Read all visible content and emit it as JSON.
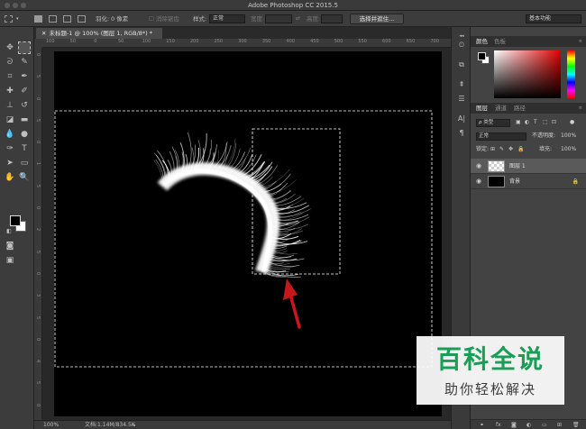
{
  "app": {
    "title": "Adobe Photoshop CC 2015.5"
  },
  "options_bar": {
    "feather_label": "羽化:",
    "feather_value": "0 像素",
    "antialias_label": "消除锯齿",
    "style_label": "样式:",
    "style_value": "正常",
    "width_label": "宽度:",
    "height_label": "高度:",
    "select_mask_button": "选择并遮住...",
    "workspace_value": "基本功能"
  },
  "document": {
    "tab_label": "未标题-1 @ 100% (图层 1, RGB/8*) *",
    "zoom": "100%",
    "doc_info": "文档:1.14M/834.5K"
  },
  "rulers": {
    "h_ticks": [
      "100",
      "50",
      "0",
      "50",
      "100",
      "150",
      "200",
      "250",
      "300",
      "350",
      "400",
      "450",
      "500",
      "550",
      "600",
      "650",
      "700"
    ],
    "v_ticks": [
      "0",
      "5",
      "0",
      "5",
      "0",
      "1",
      "5",
      "0",
      "2",
      "5",
      "0",
      "3",
      "5",
      "0",
      "4",
      "5",
      "0"
    ]
  },
  "panels": {
    "color_tabs": [
      "颜色",
      "色板"
    ],
    "layers_tabs": [
      "图层",
      "通道",
      "路径"
    ],
    "filter_label": "ρ 类型",
    "blend_mode": "正常",
    "opacity_label": "不透明度:",
    "opacity_value": "100%",
    "lock_label": "锁定:",
    "fill_label": "填充:",
    "fill_value": "100%",
    "layers": [
      {
        "name": "图层 1",
        "selected": true
      },
      {
        "name": "背景",
        "locked": true
      }
    ],
    "bottom_icons": [
      "fx"
    ]
  },
  "watermark": {
    "title": "百科全说",
    "subtitle": "助你轻松解决"
  },
  "colors": {
    "canvas_bg": "#000000",
    "selection": "#ffffff",
    "arrow": "#c8161d",
    "brand_green": "#1a9d56"
  }
}
